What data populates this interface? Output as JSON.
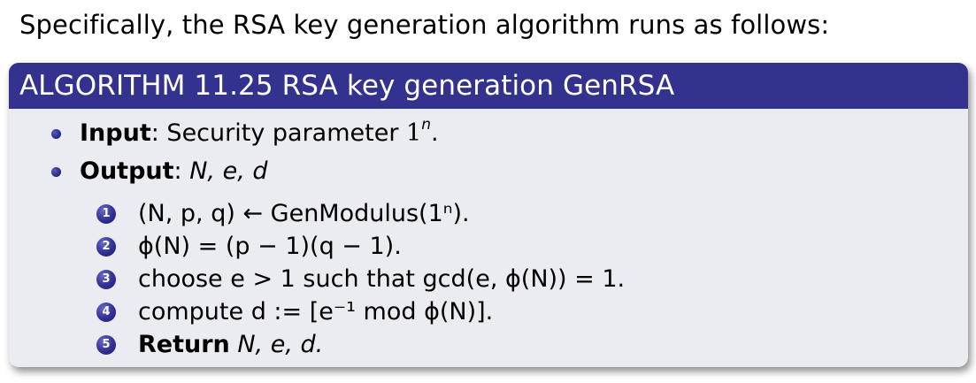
{
  "intro": {
    "text": "Specifically, the RSA key generation algorithm runs as follows:"
  },
  "block": {
    "title": "ALGORITHM 11.25 RSA key generation GenRSA",
    "input": {
      "label": "Input",
      "sep": ":",
      "text": " Security parameter ",
      "one": "1",
      "exp": "n",
      "end": "."
    },
    "output": {
      "label": "Output",
      "sep": ":",
      "text": " N, e, d"
    },
    "steps": [
      {
        "num": "1",
        "text": "(N, p, q) ← GenModulus(1ⁿ)."
      },
      {
        "num": "2",
        "text": "ϕ(N) = (p − 1)(q − 1)."
      },
      {
        "num": "3",
        "text": "choose e > 1 such that gcd(e, ϕ(N)) = 1."
      },
      {
        "num": "4",
        "text": "compute d := [e⁻¹  mod ϕ(N)]."
      },
      {
        "num": "5",
        "bold": "Return",
        "text": " N, e, d."
      }
    ]
  }
}
